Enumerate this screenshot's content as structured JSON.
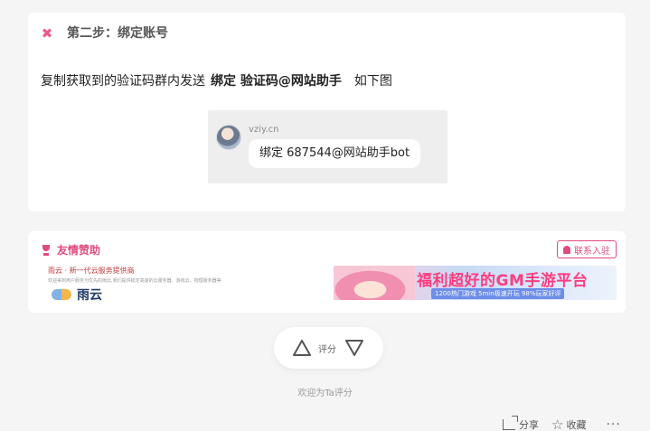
{
  "step": {
    "close_glyph": "✖",
    "title": "第二步：绑定账号",
    "desc_prefix": "复制获取到的验证码群内发送",
    "desc_bold": "绑定 验证码@网站助手",
    "desc_suffix": "如下图",
    "chat": {
      "name": "vziy.cn",
      "message": "绑定 687544@网站助手bot"
    }
  },
  "sponsor": {
    "title": "友情赞助",
    "contact_label": "联系入驻",
    "left_banner": {
      "headline": "雨云 · 新一代云服务提供商",
      "body": "欢迎来到用户服务为优先的雨云,我们提供稳定高速的云服务器、游戏云、物理服务器等",
      "brand": "雨云"
    },
    "right_banner": {
      "headline": "福利超好的GM手游平台",
      "sub": "1200热门游戏 5min极速开玩 98%玩家好评"
    }
  },
  "rating": {
    "label": "评分",
    "hint": "欢迎为Ta评分"
  },
  "footer": {
    "share": "分享",
    "favorite": "收藏",
    "more": "···"
  },
  "colors": {
    "accent": "#e04c7c",
    "card": "#ffffff",
    "page_bg": "#f5f5f5"
  }
}
